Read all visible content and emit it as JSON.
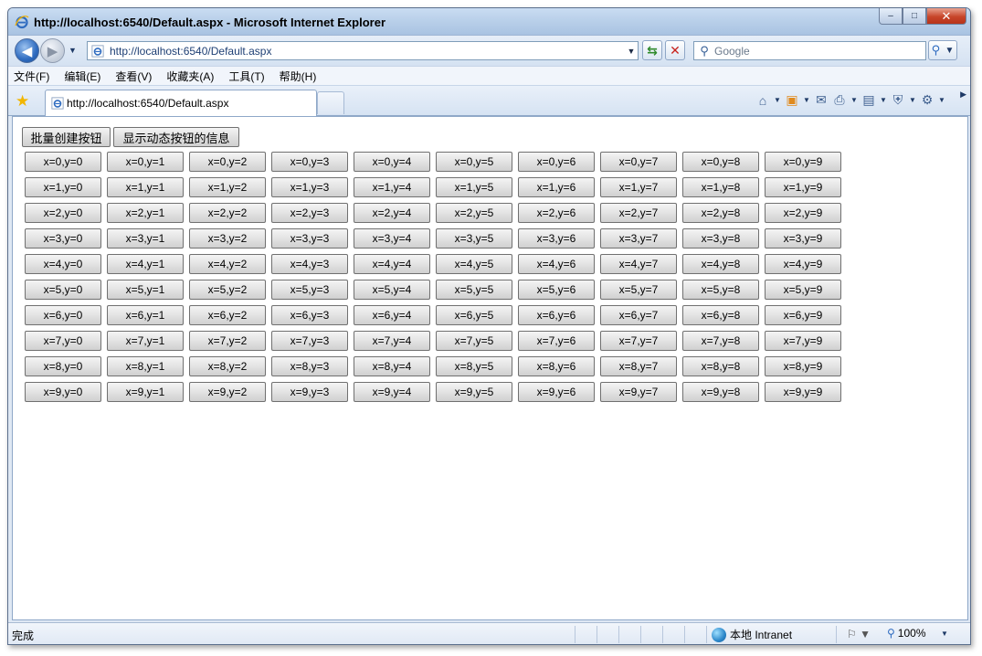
{
  "window": {
    "title": "http://localhost:6540/Default.aspx - Microsoft Internet Explorer",
    "controls": {
      "minimize": "–",
      "maximize": "□",
      "close": "✕"
    }
  },
  "address_bar": {
    "url": "http://localhost:6540/Default.aspx",
    "search_placeholder": "Google"
  },
  "menu": {
    "items": [
      "文件(F)",
      "编辑(E)",
      "查看(V)",
      "收藏夹(A)",
      "工具(T)",
      "帮助(H)"
    ]
  },
  "tab": {
    "label": "http://localhost:6540/Default.aspx"
  },
  "page": {
    "batch_create_label": "批量创建按钮",
    "show_info_label": "显示动态按钮的信息",
    "grid_rows": 10,
    "grid_cols": 10,
    "grid_label_format": "x={x},y={y}"
  },
  "status": {
    "text": "完成",
    "zone": "本地 Intranet",
    "zoom": "100%"
  },
  "colors": {
    "ie_blue": "#2f6cc0",
    "status_green": "#2f8a2c",
    "stop_red": "#c8231d"
  }
}
